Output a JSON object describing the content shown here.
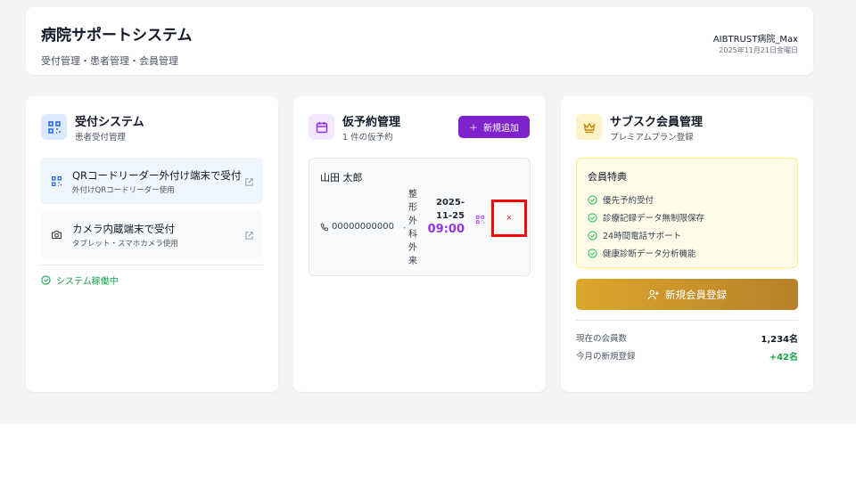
{
  "header": {
    "title": "病院サポートシステム",
    "subtitle": "受付管理・患者管理・会員管理",
    "user": "AIBTRUST病院_Max",
    "date": "2025年11月21日金曜日"
  },
  "reception": {
    "title": "受付システム",
    "subtitle": "患者受付管理",
    "options": [
      {
        "title": "QRコードリーダー外付け端末で受付",
        "sub": "外付けQRコードリーダー使用"
      },
      {
        "title": "カメラ内蔵端末で受付",
        "sub": "タブレット・スマホカメラ使用"
      }
    ],
    "status": "システム稼働中"
  },
  "reservation": {
    "title": "仮予約管理",
    "subtitle": "1 件の仮予約",
    "add_label": "新規追加",
    "items": [
      {
        "name": "山田 太郎",
        "phone": "00000000000",
        "separator": "・",
        "department": "整形外科外来",
        "date": "2025-11-25",
        "time": "09:00",
        "delete_label": "×"
      }
    ]
  },
  "membership": {
    "title": "サブスク会員管理",
    "subtitle": "プレミアムプラン登録",
    "benefits_title": "会員特典",
    "benefits": [
      "優先予約受付",
      "診療記録データ無制限保存",
      "24時間電話サポート",
      "健康診断データ分析機能"
    ],
    "register_label": "新規会員登録",
    "stats": [
      {
        "label": "現在の会員数",
        "value": "1,234名",
        "color": "#111827"
      },
      {
        "label": "今月の新規登録",
        "value": "+42名",
        "color": "#16a34a"
      }
    ]
  },
  "colors": {
    "purple": "#7e22ce",
    "green": "#16a34a",
    "gold": "#dba72c",
    "highlight": "#ff0000"
  }
}
